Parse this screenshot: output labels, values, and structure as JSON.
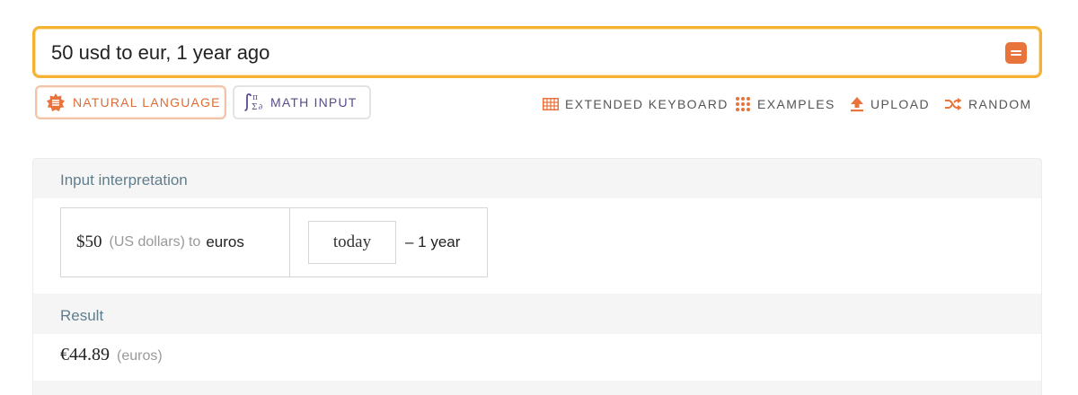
{
  "search": {
    "query": "50 usd to eur, 1 year ago"
  },
  "modes": {
    "natural_language": "NATURAL LANGUAGE",
    "math_input": "MATH INPUT"
  },
  "toolbar": {
    "extended_keyboard": "EXTENDED KEYBOARD",
    "examples": "EXAMPLES",
    "upload": "UPLOAD",
    "random": "RANDOM"
  },
  "input_interpretation": {
    "title": "Input interpretation",
    "amount": "$50",
    "amount_unit": "(US dollars)",
    "to_word": "to",
    "target": "euros",
    "time_base": "today",
    "time_offset": "– 1 year"
  },
  "result": {
    "title": "Result",
    "value": "€44.89",
    "unit": "(euros)"
  },
  "colors": {
    "accent_orange": "#e8733b",
    "search_border": "#f4b133",
    "math_purple": "#5a4b8c",
    "pod_title": "#5f7d8c"
  },
  "icons": {
    "natural_language": "sun-badge-icon",
    "math_input": "integral-pi-sigma-icon",
    "extended_keyboard": "keyboard-grid-icon",
    "examples": "dot-grid-icon",
    "upload": "upload-arrow-icon",
    "random": "shuffle-icon",
    "submit": "equals-icon"
  }
}
